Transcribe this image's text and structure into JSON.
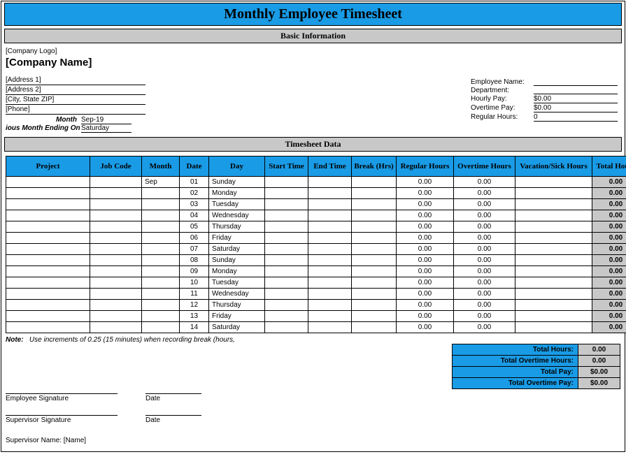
{
  "title": "Monthly Employee Timesheet",
  "sections": {
    "basic": "Basic Information",
    "data": "Timesheet Data"
  },
  "company": {
    "logo": "[Company Logo]",
    "name": "[Company Name]",
    "address1": "[Address 1]",
    "address2": "[Address 2]",
    "citystatezip": "[City, State ZIP]",
    "phone": "[Phone]"
  },
  "period": {
    "month_label": "Month",
    "month_value": "Sep-19",
    "ending_label": "ious Month Ending On",
    "ending_value": "Saturday"
  },
  "employee": {
    "name_label": "Employee Name:",
    "name_value": "",
    "dept_label": "Department:",
    "dept_value": "",
    "hourly_label": "Hourly Pay:",
    "hourly_value": "$0.00",
    "ot_label": "Overtime Pay:",
    "ot_value": "$0.00",
    "reg_label": "Regular Hours:",
    "reg_value": "0"
  },
  "headers": {
    "project": "Project",
    "job": "Job Code",
    "month": "Month",
    "date": "Date",
    "day": "Day",
    "start": "Start Time",
    "end": "End Time",
    "break": "Break (Hrs)",
    "reg": "Regular Hours",
    "ot": "Overtime Hours",
    "vac": "Vacation/Sick Hours",
    "total": "Total Hours"
  },
  "rows": [
    {
      "project": "",
      "job": "",
      "month": "Sep",
      "date": "01",
      "day": "Sunday",
      "start": "",
      "end": "",
      "break": "",
      "reg": "0.00",
      "ot": "0.00",
      "vac": "",
      "total": "0.00"
    },
    {
      "project": "",
      "job": "",
      "month": "",
      "date": "02",
      "day": "Monday",
      "start": "",
      "end": "",
      "break": "",
      "reg": "0.00",
      "ot": "0.00",
      "vac": "",
      "total": "0.00"
    },
    {
      "project": "",
      "job": "",
      "month": "",
      "date": "03",
      "day": "Tuesday",
      "start": "",
      "end": "",
      "break": "",
      "reg": "0.00",
      "ot": "0.00",
      "vac": "",
      "total": "0.00"
    },
    {
      "project": "",
      "job": "",
      "month": "",
      "date": "04",
      "day": "Wednesday",
      "start": "",
      "end": "",
      "break": "",
      "reg": "0.00",
      "ot": "0.00",
      "vac": "",
      "total": "0.00"
    },
    {
      "project": "",
      "job": "",
      "month": "",
      "date": "05",
      "day": "Thursday",
      "start": "",
      "end": "",
      "break": "",
      "reg": "0.00",
      "ot": "0.00",
      "vac": "",
      "total": "0.00"
    },
    {
      "project": "",
      "job": "",
      "month": "",
      "date": "06",
      "day": "Friday",
      "start": "",
      "end": "",
      "break": "",
      "reg": "0.00",
      "ot": "0.00",
      "vac": "",
      "total": "0.00"
    },
    {
      "project": "",
      "job": "",
      "month": "",
      "date": "07",
      "day": "Saturday",
      "start": "",
      "end": "",
      "break": "",
      "reg": "0.00",
      "ot": "0.00",
      "vac": "",
      "total": "0.00"
    },
    {
      "project": "",
      "job": "",
      "month": "",
      "date": "08",
      "day": "Sunday",
      "start": "",
      "end": "",
      "break": "",
      "reg": "0.00",
      "ot": "0.00",
      "vac": "",
      "total": "0.00"
    },
    {
      "project": "",
      "job": "",
      "month": "",
      "date": "09",
      "day": "Monday",
      "start": "",
      "end": "",
      "break": "",
      "reg": "0.00",
      "ot": "0.00",
      "vac": "",
      "total": "0.00"
    },
    {
      "project": "",
      "job": "",
      "month": "",
      "date": "10",
      "day": "Tuesday",
      "start": "",
      "end": "",
      "break": "",
      "reg": "0.00",
      "ot": "0.00",
      "vac": "",
      "total": "0.00"
    },
    {
      "project": "",
      "job": "",
      "month": "",
      "date": "11",
      "day": "Wednesday",
      "start": "",
      "end": "",
      "break": "",
      "reg": "0.00",
      "ot": "0.00",
      "vac": "",
      "total": "0.00"
    },
    {
      "project": "",
      "job": "",
      "month": "",
      "date": "12",
      "day": "Thursday",
      "start": "",
      "end": "",
      "break": "",
      "reg": "0.00",
      "ot": "0.00",
      "vac": "",
      "total": "0.00"
    },
    {
      "project": "",
      "job": "",
      "month": "",
      "date": "13",
      "day": "Friday",
      "start": "",
      "end": "",
      "break": "",
      "reg": "0.00",
      "ot": "0.00",
      "vac": "",
      "total": "0.00"
    },
    {
      "project": "",
      "job": "",
      "month": "",
      "date": "14",
      "day": "Saturday",
      "start": "",
      "end": "",
      "break": "",
      "reg": "0.00",
      "ot": "0.00",
      "vac": "",
      "total": "0.00"
    }
  ],
  "note_label": "Note:",
  "note_text": "Use increments of 0.25 (15 minutes) when recording break (hours,",
  "totals": {
    "hours_label": "Total Hours:",
    "hours_value": "0.00",
    "ot_hours_label": "Total Overtime Hours:",
    "ot_hours_value": "0.00",
    "pay_label": "Total Pay:",
    "pay_value": "$0.00",
    "ot_pay_label": "Total Overtime Pay:",
    "ot_pay_value": "$0.00"
  },
  "signatures": {
    "emp_sig": "Employee Signature",
    "date": "Date",
    "sup_sig": "Supervisor Signature",
    "sup_name": "Supervisor Name: [Name]"
  }
}
